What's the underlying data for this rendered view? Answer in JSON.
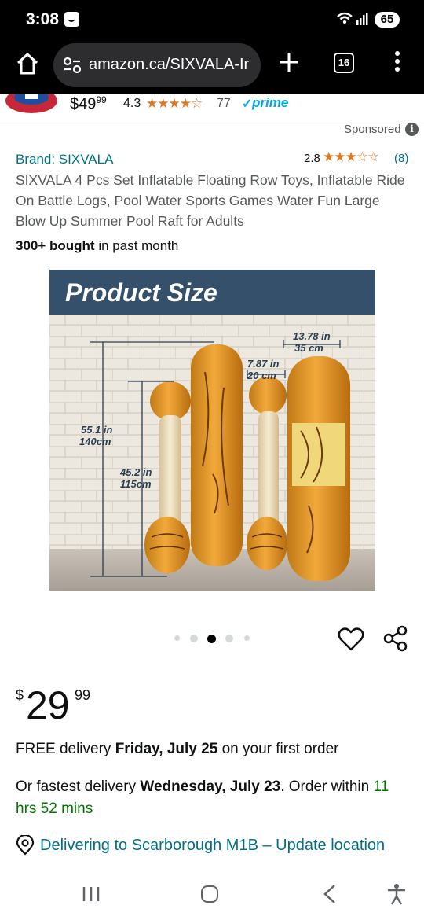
{
  "status": {
    "time": "3:08",
    "battery": "65"
  },
  "browser": {
    "url": "amazon.ca/SIXVALA-Ir",
    "tab_count": "16"
  },
  "sticky": {
    "price_whole": "$49",
    "price_fraction": "99",
    "rating": "4.3",
    "stars": "★★★★☆",
    "review_count": "77",
    "prime_check": "✓",
    "prime_label": "prime"
  },
  "sponsored": {
    "label": "Sponsored",
    "info_glyph": "i"
  },
  "product": {
    "brand": "Brand: SIXVALA",
    "rating": "2.8",
    "stars": "★★★☆☆",
    "rating_count": "(8)",
    "title": "SIXVALA 4 Pcs Set Inflatable Floating Row Toys, Inflatable Ride On Battle Logs, Pool Water Sports Games Water Fun Large Blow Up Summer Pool Raft for Adults",
    "bought_bold": "300+ bought",
    "bought_rest": " in past month"
  },
  "image": {
    "title": "Product Size",
    "dim_tall_in": "55.1 in",
    "dim_tall_cm": "140cm",
    "dim_short_in": "45.2 in",
    "dim_short_cm": "115cm",
    "dim_narrow_in": "7.87 in",
    "dim_narrow_cm": "20 cm",
    "dim_wide_in": "13.78 in",
    "dim_wide_cm": "35 cm",
    "active_index": 2,
    "total_images": 5
  },
  "price": {
    "symbol": "$",
    "whole": "29",
    "fraction": "99"
  },
  "delivery": {
    "free_prefix": "FREE delivery ",
    "free_date": "Friday, July 25",
    "free_suffix": " on your first order",
    "fast_prefix": "Or fastest delivery ",
    "fast_date": "Wednesday, July 23",
    "fast_mid": ". Order within ",
    "fast_countdown": "11 hrs 52 mins"
  },
  "location": {
    "text": "Delivering to Scarborough M1B – Update location"
  },
  "colors": {
    "link": "#007185",
    "star": "#de7921",
    "green": "#007600",
    "prime": "#00a8e1",
    "image_header": "#34506a"
  }
}
